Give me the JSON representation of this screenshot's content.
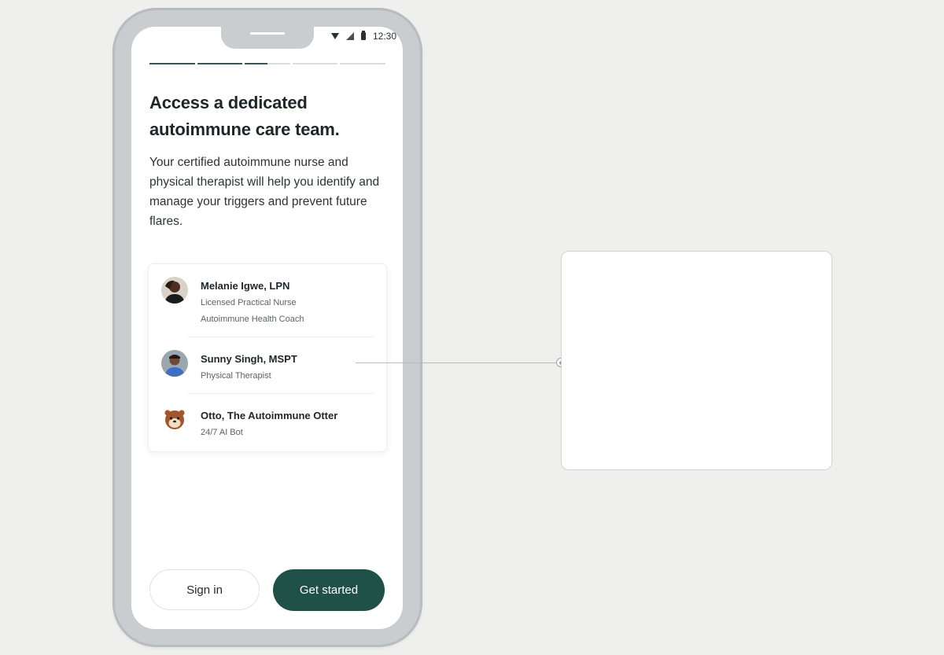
{
  "status_bar": {
    "time": "12:30"
  },
  "onboarding": {
    "progress_steps": [
      {
        "filled": 1.0
      },
      {
        "filled": 1.0
      },
      {
        "filled": 0.5
      },
      {
        "filled": 0.0
      },
      {
        "filled": 0.0
      }
    ],
    "title": "Access a dedicated autoimmune care team.",
    "description": "Your certified autoimmune nurse and physical therapist will help you identify and manage your triggers and prevent future flares."
  },
  "care_team": [
    {
      "name": "Melanie Igwe, LPN",
      "roles": [
        "Licensed Practical Nurse",
        "Autoimmune Health Coach"
      ]
    },
    {
      "name": "Sunny Singh, MSPT",
      "roles": [
        "Physical Therapist"
      ]
    },
    {
      "name": "Otto, The Autoimmune Otter",
      "roles": [
        "24/7 AI Bot"
      ]
    }
  ],
  "actions": {
    "sign_in_label": "Sign in",
    "get_started_label": "Get started"
  },
  "colors": {
    "primary": "#1f5149",
    "frame": "#c9cdcf",
    "background": "#efefee"
  }
}
